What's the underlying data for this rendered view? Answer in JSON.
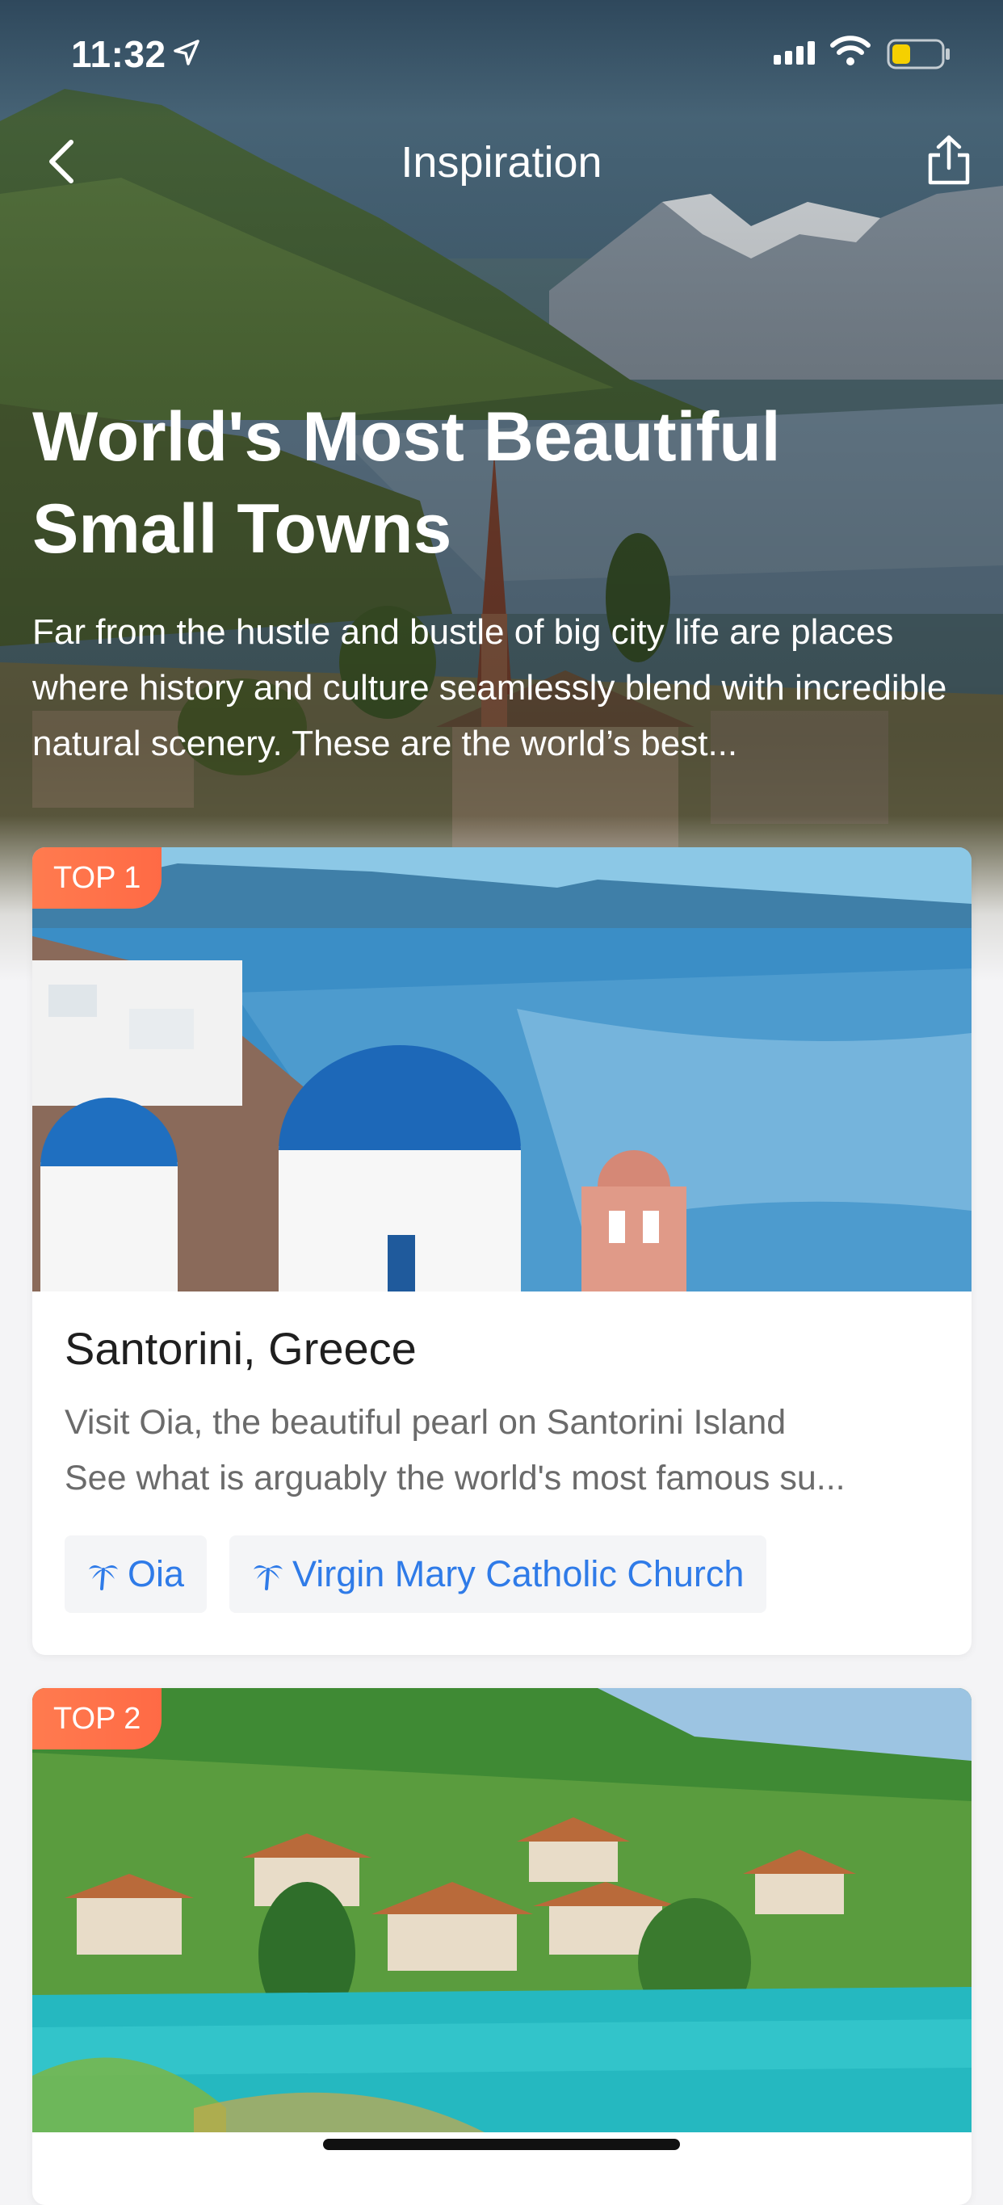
{
  "status_bar": {
    "time": "11:32"
  },
  "nav": {
    "title": "Inspiration"
  },
  "hero": {
    "title_line1": "World's Most Beautiful",
    "title_line2": "Small Towns",
    "description": "Far from the hustle and bustle of big city life are places where history and culture seamlessly blend with incredible natural scenery. These are the world’s best..."
  },
  "cards": [
    {
      "rank": "TOP 1",
      "name": "Santorini, Greece",
      "desc_line1": "Visit Oia, the beautiful pearl on Santorini Island",
      "desc_line2": "See what is arguably the world's most famous su...",
      "tags": [
        "Oia",
        "Virgin Mary Catholic Church"
      ]
    },
    {
      "rank": "TOP 2"
    }
  ],
  "colors": {
    "accent": "#2f7be8",
    "rank_badge": "#ff6e47",
    "battery": "#f5d000"
  }
}
